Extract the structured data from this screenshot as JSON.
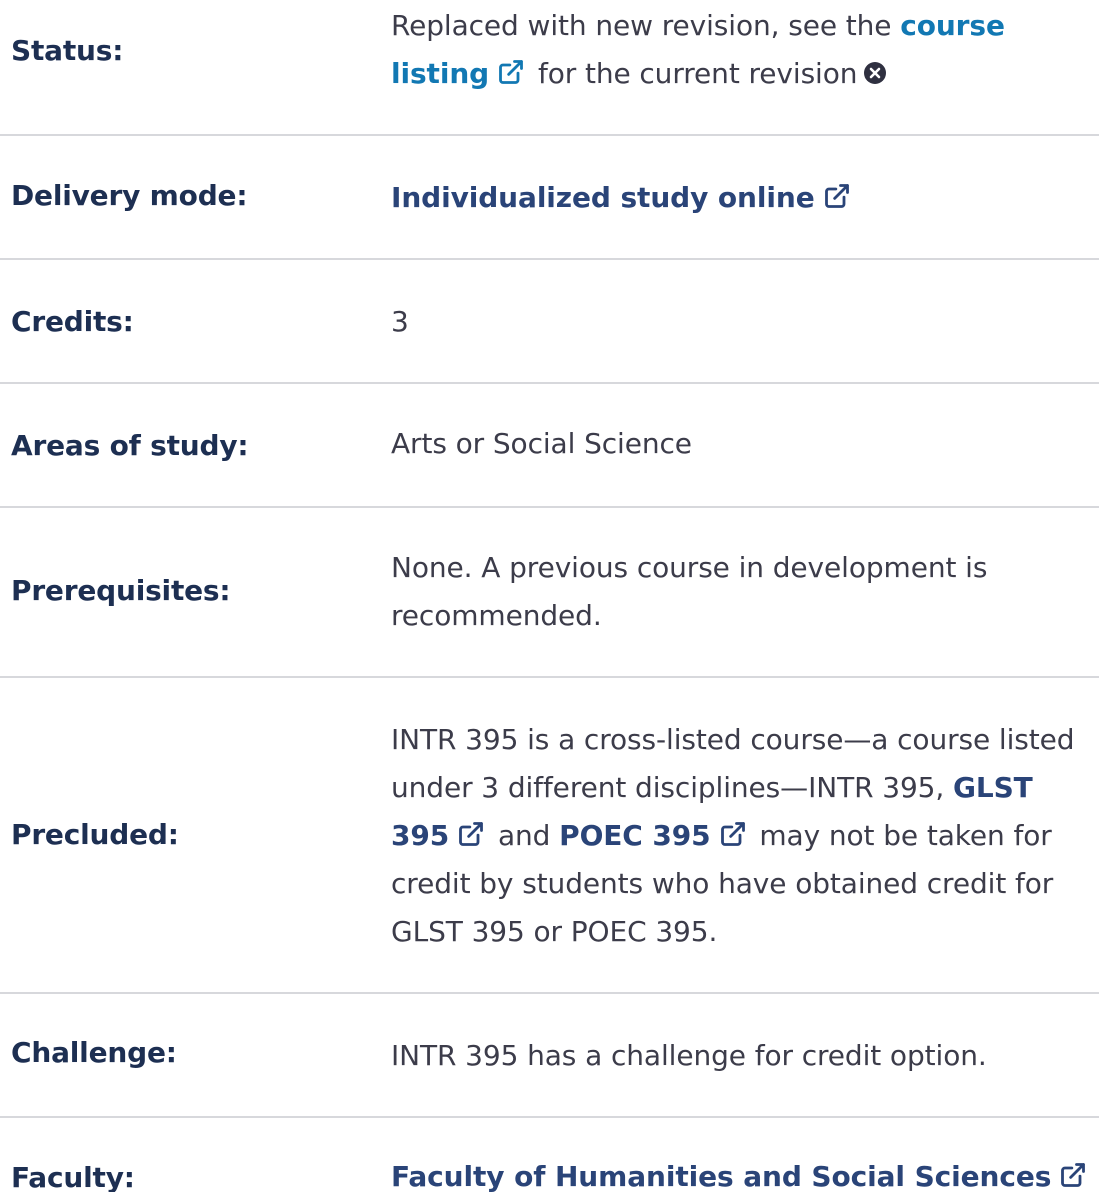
{
  "colors": {
    "label": "#1d2f52",
    "link": "#2a4478",
    "link_teal": "#1278b3",
    "text": "#3c3c4a",
    "divider": "#d7d8dc"
  },
  "rows": {
    "status": {
      "label": "Status:",
      "text_before": "Replaced with new revision, see the ",
      "link_line1": "course",
      "link_line2": "listing",
      "text_after": "for the current revision",
      "link_icon": "external-link-icon",
      "trailing_icon": "circle-x-icon"
    },
    "delivery": {
      "label": "Delivery mode:",
      "link": "Individualized study online",
      "link_icon": "external-link-icon"
    },
    "credits": {
      "label": "Credits:",
      "value": "3"
    },
    "areas": {
      "label": "Areas of study:",
      "value": "Arts or Social Science"
    },
    "prereq": {
      "label": "Prerequisites:",
      "line1": "None. A previous course in development is",
      "line2": "recommended."
    },
    "precluded": {
      "label": "Precluded:",
      "line1": "INTR 395 is a cross-listed course—a course listed",
      "line2_text": "under 3 different disciplines—INTR 395, ",
      "link_glst_line2": "GLST",
      "link_glst_line3": "395",
      "line3_mid": "and ",
      "link_poec": "POEC 395",
      "line3_end": "may not be taken for",
      "line4": "credit by students who have obtained credit for",
      "line5": "GLST 395 or POEC 395."
    },
    "challenge": {
      "label": "Challenge:",
      "value": "INTR 395 has a challenge for credit option."
    },
    "faculty": {
      "label": "Faculty:",
      "link": "Faculty of Humanities and Social Sciences",
      "link_icon": "external-link-icon"
    }
  }
}
